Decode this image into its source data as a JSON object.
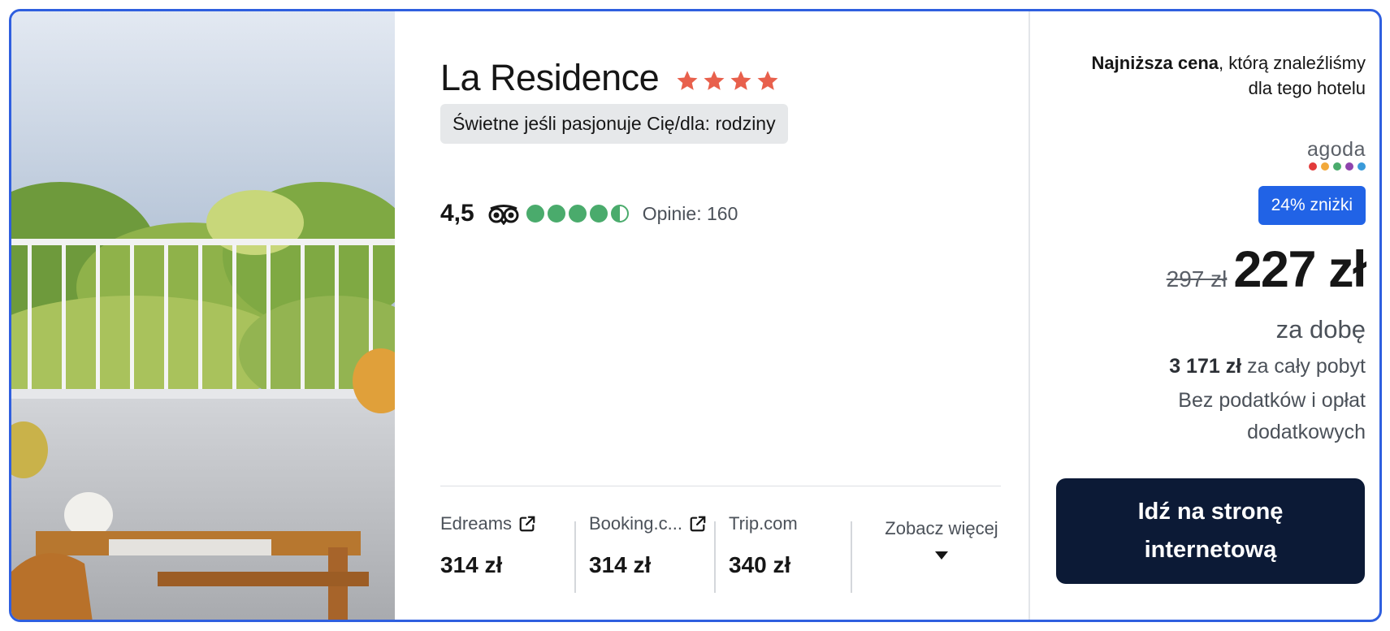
{
  "hotel": {
    "name": "La Residence",
    "stars": 4,
    "tag": "Świetne jeśli pasjonuje Cię/dla: rodziny"
  },
  "rating": {
    "score": "4,5",
    "bubbles": 4.5,
    "reviews_label": "Opinie: 160"
  },
  "providers": [
    {
      "name": "Edreams",
      "price": "314 zł"
    },
    {
      "name": "Booking.c...",
      "price": "314 zł"
    },
    {
      "name": "Trip.com",
      "price": "340 zł"
    }
  ],
  "see_more_label": "Zobacz więcej",
  "deal": {
    "lowest_bold": "Najniższa cena",
    "lowest_rest": ", którą znaleźliśmy dla tego hotelu",
    "provider_logo_text": "agoda",
    "provider_colors": [
      "#e23b3b",
      "#f2a93b",
      "#4aab6c",
      "#8e44ad",
      "#3a9ad9"
    ],
    "discount_label": "24% zniżki",
    "old_price": "297 zł",
    "price": "227 zł",
    "per_night": "za dobę",
    "total_amount": "3 171 zł",
    "total_suffix": " za cały pobyt",
    "taxes_note": "Bez podatków i opłat dodatkowych",
    "cta_label": "Idź na stronę internetową"
  },
  "colors": {
    "border": "#2f5fdf",
    "star": "#e8604c",
    "bubble": "#4aab6c",
    "discount": "#2163e6",
    "cta": "#0c1a36"
  }
}
